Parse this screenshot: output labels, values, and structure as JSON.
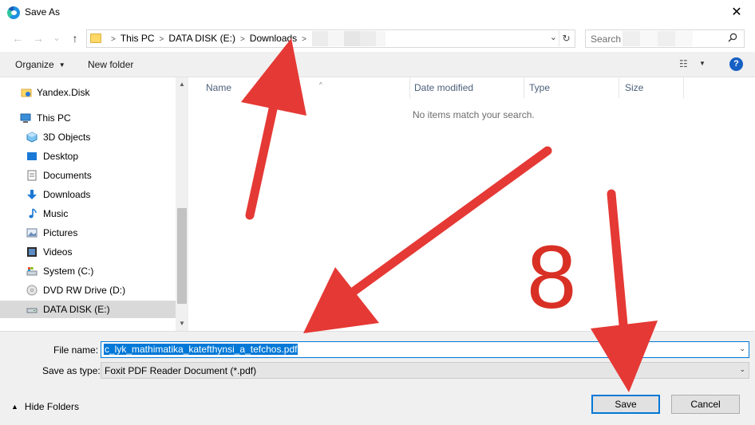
{
  "window": {
    "title": "Save As",
    "app_icon": "edge-icon",
    "close_glyph": "✕"
  },
  "nav": {
    "back_glyph": "←",
    "forward_glyph": "→",
    "recent_glyph": "⌄",
    "up_glyph": "↑"
  },
  "address": {
    "crumbs": [
      "This PC",
      "DATA DISK (E:)",
      "Downloads"
    ],
    "separator": ">",
    "dropdown_glyph": "⌄",
    "refresh_glyph": "↻"
  },
  "search": {
    "placeholder": "Search",
    "icon_glyph": "⚲"
  },
  "toolbar": {
    "organize_label": "Organize",
    "new_folder_label": "New folder",
    "caret_glyph": "▼",
    "view_glyph": "☷",
    "help_glyph": "?"
  },
  "sidebar": {
    "items": [
      {
        "label": "Yandex.Disk",
        "icon": "yandex-disk-icon"
      },
      {
        "label": "This PC",
        "icon": "this-pc-icon"
      },
      {
        "label": "3D Objects",
        "icon": "3d-objects-icon"
      },
      {
        "label": "Desktop",
        "icon": "desktop-icon"
      },
      {
        "label": "Documents",
        "icon": "documents-icon"
      },
      {
        "label": "Downloads",
        "icon": "downloads-icon"
      },
      {
        "label": "Music",
        "icon": "music-icon"
      },
      {
        "label": "Pictures",
        "icon": "pictures-icon"
      },
      {
        "label": "Videos",
        "icon": "videos-icon"
      },
      {
        "label": "System (C:)",
        "icon": "system-drive-icon"
      },
      {
        "label": "DVD RW Drive (D:)",
        "icon": "dvd-drive-icon"
      },
      {
        "label": "DATA DISK (E:)",
        "icon": "data-disk-icon",
        "selected": true
      }
    ],
    "scroll_up_glyph": "▲",
    "scroll_down_glyph": "▼"
  },
  "file_list": {
    "columns": [
      "Name",
      "Date modified",
      "Type",
      "Size"
    ],
    "sort_glyph": "^",
    "empty_message": "No items match your search."
  },
  "form": {
    "file_name_label": "File name:",
    "file_name_value": "c_lyk_mathimatika_katefthynsi_a_tefchos.pdf",
    "save_as_type_label": "Save as type:",
    "save_as_type_value": "Foxit PDF Reader Document (*.pdf)",
    "dropdown_glyph": "⌄"
  },
  "footer": {
    "hide_folders_label": "Hide Folders",
    "hide_folders_glyph": "▲",
    "save_label": "Save",
    "cancel_label": "Cancel"
  },
  "annotation": {
    "step_number": "8",
    "arrow_color": "#e53935"
  }
}
